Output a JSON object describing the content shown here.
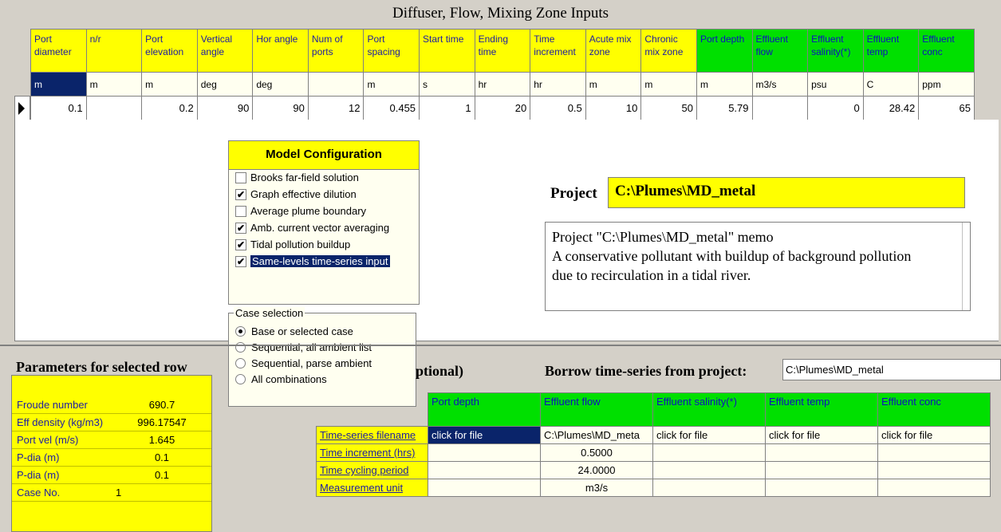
{
  "title": "Diffuser, Flow, Mixing Zone Inputs",
  "grid": {
    "headers": [
      {
        "label": "Port diameter",
        "color": "yellow"
      },
      {
        "label": "n/r",
        "color": "yellow"
      },
      {
        "label": "Port elevation",
        "color": "yellow"
      },
      {
        "label": "Vertical angle",
        "color": "yellow"
      },
      {
        "label": "Hor angle",
        "color": "yellow"
      },
      {
        "label": "Num of ports",
        "color": "yellow"
      },
      {
        "label": "Port spacing",
        "color": "yellow"
      },
      {
        "label": "Start time",
        "color": "yellow"
      },
      {
        "label": "Ending time",
        "color": "yellow"
      },
      {
        "label": "Time increment",
        "color": "yellow"
      },
      {
        "label": "Acute mix zone",
        "color": "yellow"
      },
      {
        "label": "Chronic mix zone",
        "color": "yellow"
      },
      {
        "label": "Port depth",
        "color": "green"
      },
      {
        "label": "Effluent flow",
        "color": "green"
      },
      {
        "label": "Effluent salinity(*)",
        "color": "green"
      },
      {
        "label": "Effluent temp",
        "color": "green"
      },
      {
        "label": "Effluent conc",
        "color": "green"
      }
    ],
    "units": [
      "m",
      "m",
      "m",
      "deg",
      "deg",
      "",
      "m",
      "s",
      "hr",
      "hr",
      "m",
      "m",
      "m",
      "m3/s",
      "psu",
      "C",
      "ppm"
    ],
    "values": [
      "0.1",
      "",
      "0.2",
      "90",
      "90",
      "12",
      "0.455",
      "1",
      "20",
      "0.5",
      "10",
      "50",
      "5.79",
      "",
      "0",
      "28.42",
      "65"
    ]
  },
  "model_config": {
    "title": "Model Configuration",
    "items": [
      {
        "label": "Brooks far-field solution",
        "checked": false
      },
      {
        "label": "Graph effective dilution",
        "checked": true
      },
      {
        "label": "Average plume boundary",
        "checked": false
      },
      {
        "label": "Amb. current vector averaging",
        "checked": true
      },
      {
        "label": "Tidal pollution buildup",
        "checked": true
      },
      {
        "label": "Same-levels time-series input",
        "checked": true
      }
    ]
  },
  "case_selection": {
    "legend": "Case selection",
    "options": [
      {
        "label": "Base or selected case",
        "selected": true
      },
      {
        "label": "Sequential, all ambient list",
        "selected": false
      },
      {
        "label": "Sequential, parse ambient",
        "selected": false
      },
      {
        "label": "All combinations",
        "selected": false
      }
    ]
  },
  "project": {
    "label": "Project",
    "path": "C:\\Plumes\\MD_metal",
    "memo_lines": [
      "Project \"C:\\Plumes\\MD_metal\" memo",
      "A conservative pollutant with buildup of background pollution",
      "due to recirculation in a tidal river."
    ]
  },
  "parameters": {
    "title": "Parameters for selected row",
    "rows": [
      {
        "key": "Froude number",
        "value": "690.7"
      },
      {
        "key": "Eff density (kg/m3)",
        "value": "996.17547"
      },
      {
        "key": "Port vel (m/s)",
        "value": "1.645"
      },
      {
        "key": "P-dia (m)",
        "value": "0.1"
      },
      {
        "key": "P-dia (m)",
        "value": "0.1"
      },
      {
        "key": "Case No.",
        "value": "1"
      }
    ]
  },
  "time_series": {
    "optional_label": "ptional)",
    "borrow_label": "Borrow time-series from project:",
    "borrow_value": "C:\\Plumes\\MD_metal",
    "columns": [
      "Port depth",
      "Effluent flow",
      "Effluent salinity(*)",
      "Effluent temp",
      "Effluent conc"
    ],
    "rows": [
      {
        "label": "Time-series filename",
        "cells": [
          "click for file",
          "C:\\Plumes\\MD_meta",
          "click for file",
          "click for file",
          "click for file"
        ]
      },
      {
        "label": "Time increment (hrs)",
        "cells": [
          "",
          "0.5000",
          "",
          "",
          ""
        ]
      },
      {
        "label": "Time cycling period",
        "cells": [
          "",
          "24.0000",
          "",
          "",
          ""
        ]
      },
      {
        "label": "Measurement unit",
        "cells": [
          "",
          "m3/s",
          "",
          "",
          ""
        ]
      }
    ]
  },
  "colors": {
    "yellow": "#ffff00",
    "green": "#00e000",
    "selection": "#0a246a",
    "background": "#d4d0c8"
  }
}
